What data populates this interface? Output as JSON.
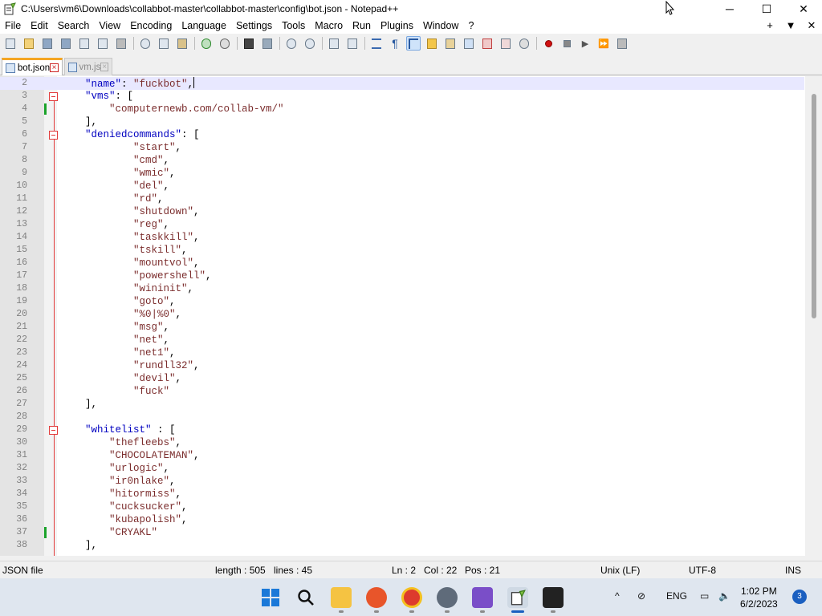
{
  "window": {
    "title": "C:\\Users\\vm6\\Downloads\\collabbot-master\\collabbot-master\\config\\bot.json - Notepad++",
    "minimize": "─",
    "maximize": "☐",
    "close": "✕"
  },
  "menu": [
    "File",
    "Edit",
    "Search",
    "View",
    "Encoding",
    "Language",
    "Settings",
    "Tools",
    "Macro",
    "Run",
    "Plugins",
    "Window",
    "?"
  ],
  "menu_right": [
    "+",
    "▼",
    "✕"
  ],
  "toolbar_icons": [
    "new-file",
    "open-file",
    "save",
    "save-all",
    "close",
    "close-all",
    "print",
    "cut",
    "copy",
    "paste",
    "undo",
    "redo",
    "find",
    "replace",
    "zoom-in",
    "zoom-out",
    "sync-vertical",
    "sync-horizontal",
    "word-wrap",
    "show-all-chars",
    "indent-guide",
    "user-defined-language",
    "doc-map",
    "function-list",
    "folder-as-workspace",
    "monitoring",
    "record-macro",
    "stop-record",
    "play-macro",
    "run-macro-multiple",
    "save-macro"
  ],
  "tabs": [
    {
      "label": "bot.json",
      "active": true
    },
    {
      "label": "vm.js",
      "active": false
    }
  ],
  "editor": {
    "lines": [
      {
        "n": "2",
        "text": "    \"name\": \"fuckbot\","
      },
      {
        "n": "3",
        "text": "    \"vms\": ["
      },
      {
        "n": "4",
        "text": "        \"computernewb.com/collab-vm/\""
      },
      {
        "n": "5",
        "text": "    ],"
      },
      {
        "n": "6",
        "text": "    \"deniedcommands\": ["
      },
      {
        "n": "7",
        "text": "            \"start\","
      },
      {
        "n": "8",
        "text": "            \"cmd\","
      },
      {
        "n": "9",
        "text": "            \"wmic\","
      },
      {
        "n": "10",
        "text": "            \"del\","
      },
      {
        "n": "11",
        "text": "            \"rd\","
      },
      {
        "n": "12",
        "text": "            \"shutdown\","
      },
      {
        "n": "13",
        "text": "            \"reg\","
      },
      {
        "n": "14",
        "text": "            \"taskkill\","
      },
      {
        "n": "15",
        "text": "            \"tskill\","
      },
      {
        "n": "16",
        "text": "            \"mountvol\","
      },
      {
        "n": "17",
        "text": "            \"powershell\","
      },
      {
        "n": "18",
        "text": "            \"wininit\","
      },
      {
        "n": "19",
        "text": "            \"goto\","
      },
      {
        "n": "20",
        "text": "            \"%0|%0\","
      },
      {
        "n": "21",
        "text": "            \"msg\","
      },
      {
        "n": "22",
        "text": "            \"net\","
      },
      {
        "n": "23",
        "text": "            \"net1\","
      },
      {
        "n": "24",
        "text": "            \"rundll32\","
      },
      {
        "n": "25",
        "text": "            \"devil\","
      },
      {
        "n": "26",
        "text": "            \"fuck\""
      },
      {
        "n": "27",
        "text": "    ],"
      },
      {
        "n": "28",
        "text": ""
      },
      {
        "n": "29",
        "text": "    \"whitelist\" : ["
      },
      {
        "n": "30",
        "text": "        \"thefleebs\","
      },
      {
        "n": "31",
        "text": "        \"CHOCOLATEMAN\","
      },
      {
        "n": "32",
        "text": "        \"urlogic\","
      },
      {
        "n": "33",
        "text": "        \"ir0nlake\","
      },
      {
        "n": "34",
        "text": "        \"hitormiss\","
      },
      {
        "n": "35",
        "text": "        \"cucksucker\","
      },
      {
        "n": "36",
        "text": "        \"kubapolish\","
      },
      {
        "n": "37",
        "text": "        \"CRYAKL\""
      },
      {
        "n": "38",
        "text": "    ],"
      }
    ],
    "current_line": "2",
    "changed_lines": [
      "4",
      "37"
    ],
    "fold_lines": [
      "3",
      "6",
      "29"
    ]
  },
  "status": {
    "filetype": "JSON file",
    "length": "length : 505",
    "lines": "lines : 45",
    "ln": "Ln : 2",
    "col": "Col : 22",
    "pos": "Pos : 21",
    "eol": "Unix (LF)",
    "encoding": "UTF-8",
    "mode": "INS"
  },
  "taskbar": {
    "apps": [
      "start-button",
      "search",
      "file-explorer",
      "firefox",
      "chrome",
      "settings",
      "visual-studio",
      "notepad-plus-plus",
      "terminal"
    ],
    "tray": {
      "chevron": "^",
      "lang": "ENG"
    },
    "time": "1:02 PM",
    "date": "6/2/2023",
    "notifications": "3"
  },
  "colors": {
    "keyword": "#0000c0",
    "string": "#7b2d2d",
    "fold": "#e23a3a",
    "change": "#1aa32a",
    "active_tab": "#f5a623"
  }
}
